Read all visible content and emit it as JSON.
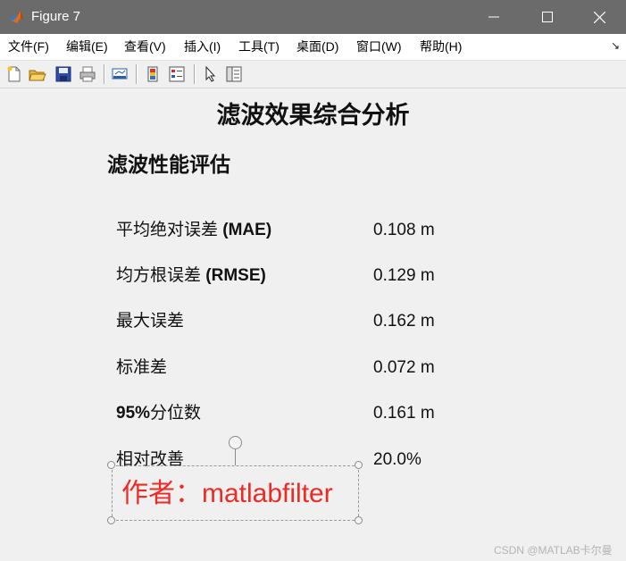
{
  "window": {
    "title": "Figure 7",
    "controls": {
      "minimize": "minimize-icon",
      "maximize": "maximize-icon",
      "close": "close-icon"
    }
  },
  "menubar": {
    "items": [
      {
        "label": "文件(F)"
      },
      {
        "label": "编辑(E)"
      },
      {
        "label": "查看(V)"
      },
      {
        "label": "插入(I)"
      },
      {
        "label": "工具(T)"
      },
      {
        "label": "桌面(D)"
      },
      {
        "label": "窗口(W)"
      },
      {
        "label": "帮助(H)"
      }
    ],
    "dock_arrow": "↘"
  },
  "toolbar": {
    "icons": [
      "new-figure-icon",
      "open-file-icon",
      "save-icon",
      "print-icon",
      "link-plot-icon",
      "colorbar-icon",
      "legend-icon",
      "pointer-icon",
      "property-inspector-icon"
    ]
  },
  "figure": {
    "title": "滤波效果综合分析",
    "subtitle": "滤波性能评估",
    "metrics": [
      {
        "label_cjk": "平均绝对误差 ",
        "label_bold": "(MAE)",
        "value": "0.108 m"
      },
      {
        "label_cjk": "均方根误差 ",
        "label_bold": "(RMSE)",
        "value": "0.129 m"
      },
      {
        "label_cjk": "最大误差",
        "label_bold": "",
        "value": "0.162 m"
      },
      {
        "label_cjk": "标准差",
        "label_bold": "",
        "value": "0.072 m"
      },
      {
        "label_bold_prefix": "95%",
        "label_cjk": "分位数",
        "value": "0.161 m"
      },
      {
        "label_cjk": "相对改善",
        "label_bold": "",
        "value": "20.0%"
      }
    ],
    "annotation": {
      "text": "作者：matlabfilter",
      "color": "#ee2a24"
    }
  },
  "watermark": "CSDN @MATLAB卡尔曼",
  "colors": {
    "titlebar": "#6b6b6b",
    "menubar": "#ffffff",
    "canvas": "#f0f0f0"
  }
}
